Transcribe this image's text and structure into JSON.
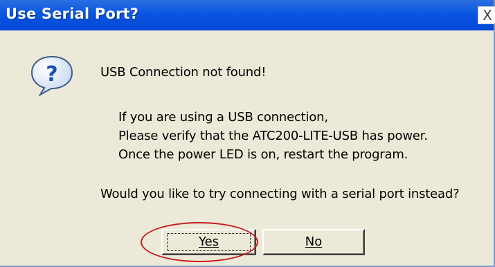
{
  "window": {
    "title": "Use Serial Port?",
    "close_glyph": "X"
  },
  "message": {
    "icon": "question-icon",
    "heading": "USB Connection not found!",
    "details": [
      "If you are using a USB connection,",
      "Please verify that the ATC200-LITE-USB has power.",
      "Once the power LED is on, restart the program."
    ],
    "question": "Would you like to try connecting with a serial port instead?"
  },
  "buttons": {
    "yes_label": "Yes",
    "no_label": "No"
  },
  "colors": {
    "titlebar": "#0a56e0",
    "dialog_bg": "#ece9d8",
    "highlight_ellipse": "#c61c1c"
  }
}
